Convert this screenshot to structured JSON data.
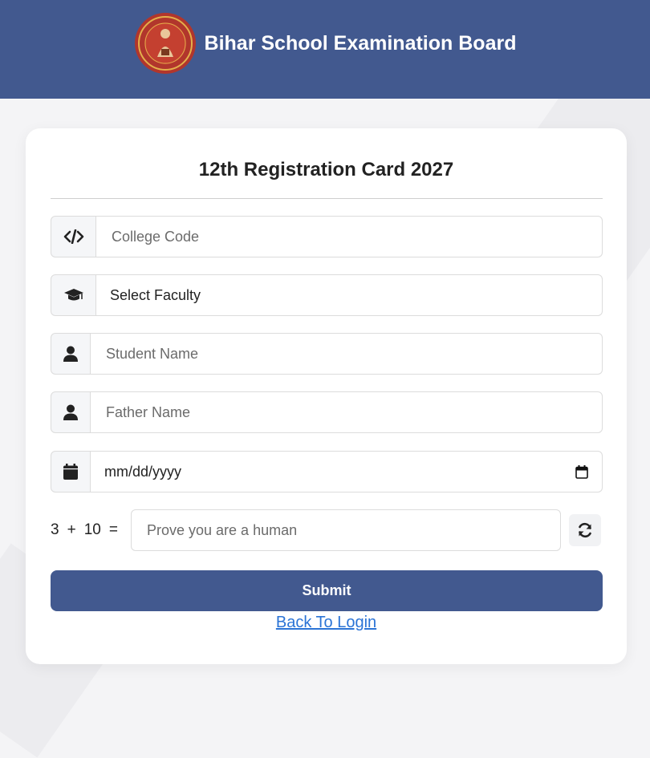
{
  "header": {
    "title": "Bihar School Examination Board",
    "logo_icon": "bseb-seal-logo"
  },
  "card": {
    "title": "12th Registration Card 2027"
  },
  "form": {
    "college_code": {
      "placeholder": "College Code",
      "icon": "code-icon"
    },
    "faculty": {
      "value": "Select Faculty",
      "icon": "graduation-cap-icon"
    },
    "student_name": {
      "placeholder": "Student Name",
      "icon": "user-icon"
    },
    "father_name": {
      "placeholder": "Father Name",
      "icon": "user-icon"
    },
    "dob": {
      "placeholder": "mm/dd/yyyy",
      "icon": "calendar-icon"
    }
  },
  "captcha": {
    "a": "3",
    "op": "+",
    "b": "10",
    "eq": "=",
    "placeholder": "Prove you are a human",
    "refresh_icon": "refresh-icon"
  },
  "actions": {
    "submit_label": "Submit",
    "back_label": "Back To Login"
  },
  "colors": {
    "brand": "#42598f",
    "link": "#2b74d6"
  }
}
